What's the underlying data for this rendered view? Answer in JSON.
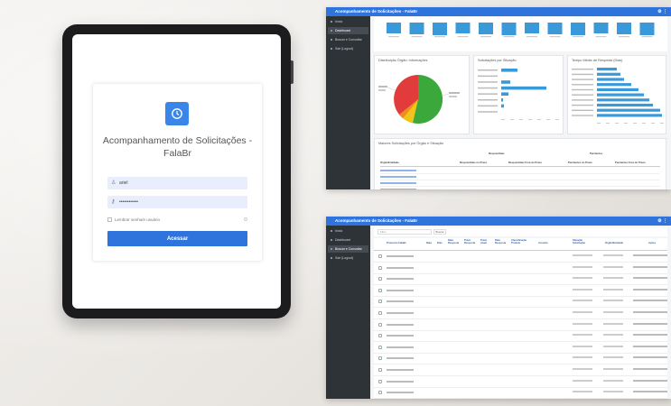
{
  "login": {
    "title": "Acompanhamento de Solicitações - FalaBr",
    "username_value": "ariel",
    "password_placeholder": "••••••••••••",
    "remember_label": "Lembrar senha/e usuário",
    "submit_label": "Acessar"
  },
  "app": {
    "window_title": "Acompanhamento de Solicitações - FalaBr",
    "sidebar_items": [
      "Início",
      "Dashboard",
      "Buscar e Consultar",
      "Sair (Logout)"
    ]
  },
  "dashboard": {
    "panel_titles": [
      "Distribuição Órgão: Informações",
      "Solicitações por Situação",
      "Tempo Médio de Resposta (Dias)"
    ],
    "table_title": "Maiores Solicitações por Órgão e Situação",
    "table_subheaders": [
      "Respondidas",
      "Pendentes"
    ],
    "table_headers": [
      "Órgão/Entidade",
      "Respondidas no Prazo",
      "Respondidas Fora do Prazo",
      "Pendentes no Prazo",
      "Pendentes Fora do Prazo"
    ]
  },
  "list": {
    "search_placeholder": "Filtro",
    "search_button": "Buscar",
    "headers": [
      "Protocolo FalaBr",
      "Data",
      "Dias",
      "Data Resposta",
      "Prazo Resposta",
      "Prazo Atual",
      "Data Resposta",
      "Classificação Produto",
      "Assunto",
      "Situação Solicitação",
      "Órgão/Entidade",
      "Ações"
    ]
  },
  "colors": {
    "accent": "#2f74dd",
    "sidebar": "#2e3338",
    "pie": [
      "#3aa83a",
      "#e23b3b",
      "#f0c419",
      "#f08a24"
    ],
    "bars": "#3a9ad9"
  }
}
